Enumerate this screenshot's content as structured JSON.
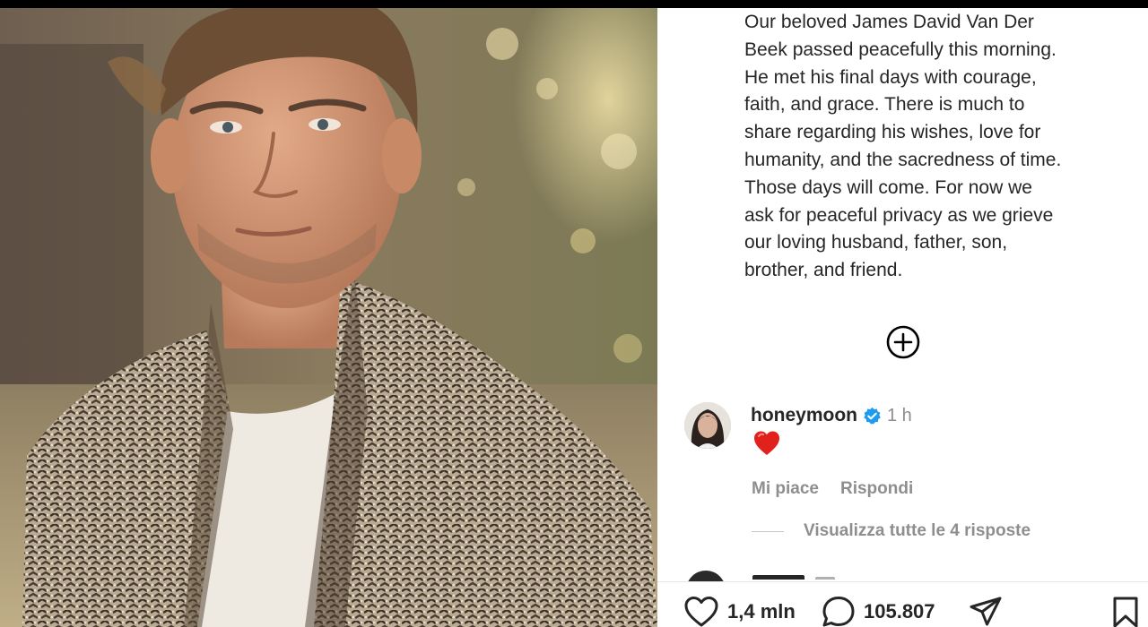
{
  "post": {
    "caption_lines": [
      "Our beloved James David Van Der",
      "Beek passed peacefully this morning.",
      "He met his final days with courage,",
      "faith, and grace.  There is much to",
      "share regarding his wishes, love for",
      "humanity, and the sacredness of time.",
      "Those days will come.  For now we",
      "ask for peaceful privacy as we grieve",
      "our loving husband, father, son,",
      "brother, and friend."
    ]
  },
  "comment": {
    "username": "honeymoon",
    "time": "1 h",
    "emoji_icon": "red-heart-emoji",
    "like_label": "Mi piace",
    "reply_label": "Rispondi"
  },
  "replies": {
    "label": "Visualizza tutte le 4 risposte"
  },
  "actions": {
    "likes_count": "1,4 mln",
    "comments_count": "105.807",
    "icons": [
      "heart-icon",
      "comment-icon",
      "share-icon",
      "bookmark-icon"
    ]
  },
  "colors": {
    "text": "#262626",
    "muted": "#8e8e8e",
    "verified": "#1d9bf0",
    "heart": "#e0211c"
  }
}
